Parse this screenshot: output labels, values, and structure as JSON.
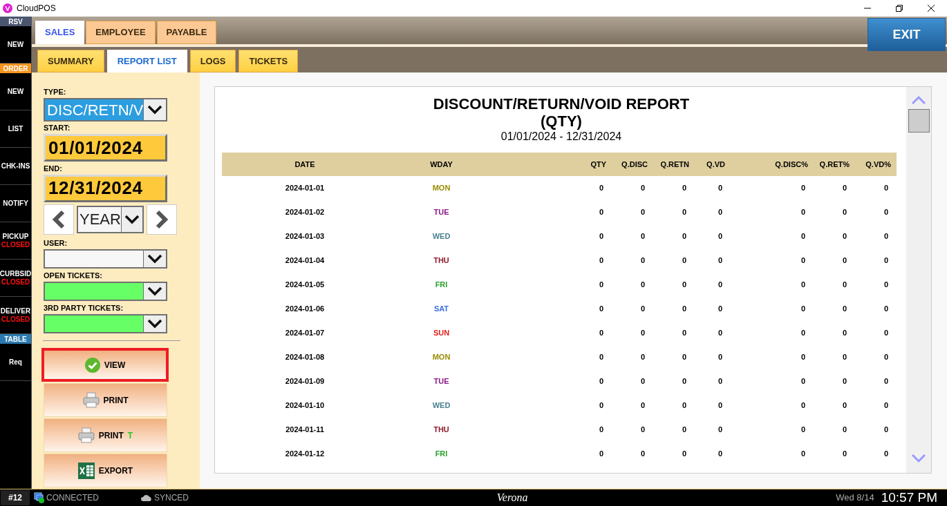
{
  "window": {
    "title": "CloudPOS"
  },
  "sidebar": [
    {
      "kind": "header",
      "label": "RSV",
      "color": "#4a5670"
    },
    {
      "kind": "item",
      "label": "NEW"
    },
    {
      "kind": "header",
      "label": "ORDER",
      "color": "#f7941d"
    },
    {
      "kind": "item",
      "label": "NEW"
    },
    {
      "kind": "item",
      "label": "LIST"
    },
    {
      "kind": "item",
      "label": "CHK-INS"
    },
    {
      "kind": "item",
      "label": "NOTIFY"
    },
    {
      "kind": "item",
      "label": "PICKUP",
      "status": "CLOSED"
    },
    {
      "kind": "item",
      "label": "CURBSID",
      "status": "CLOSED"
    },
    {
      "kind": "item",
      "label": "DELIVER",
      "status": "CLOSED"
    },
    {
      "kind": "header",
      "label": "TABLE",
      "color": "#2a7ab0"
    },
    {
      "kind": "item",
      "label": "Req"
    }
  ],
  "tabs": [
    {
      "label": "SALES",
      "selected": true
    },
    {
      "label": "EMPLOYEE",
      "selected": false
    },
    {
      "label": "PAYABLE",
      "selected": false
    }
  ],
  "exit_button": "EXIT",
  "subtabs": [
    {
      "label": "SUMMARY",
      "selected": false
    },
    {
      "label": "REPORT LIST",
      "selected": true
    },
    {
      "label": "LOGS",
      "selected": false
    },
    {
      "label": "TICKETS",
      "selected": false
    }
  ],
  "filters": {
    "type": {
      "label": "TYPE:",
      "value": "DISC/RETN/V"
    },
    "start": {
      "label": "START:",
      "value": "01/01/2024"
    },
    "end": {
      "label": "END:",
      "value": "12/31/2024"
    },
    "period": {
      "value": "YEAR"
    },
    "user": {
      "label": "USER:"
    },
    "open_tickets": {
      "label": "OPEN TICKETS:"
    },
    "third_party_tickets": {
      "label": "3RD PARTY TICKETS:"
    }
  },
  "actions": [
    {
      "kind": "view",
      "label": "VIEW",
      "selected": true
    },
    {
      "kind": "print",
      "label": "PRINT",
      "selected": false
    },
    {
      "kind": "print",
      "label": "PRINT",
      "suffix": "T",
      "selected": false
    },
    {
      "kind": "export",
      "label": "EXPORT",
      "selected": false
    }
  ],
  "report": {
    "title": "DISCOUNT/RETURN/VOID REPORT",
    "subtitle": "(QTY)",
    "range": "01/01/2024 - 12/31/2024",
    "columns": [
      "DATE",
      "WDAY",
      "QTY",
      "Q.DISC",
      "Q.RETN",
      "Q.VD",
      "Q.DISC%",
      "Q.RET%",
      "Q.VD%"
    ],
    "rows": [
      {
        "date": "2024-01-01",
        "wday": "MON",
        "color": "#9a8c00",
        "values": [
          "0",
          "0",
          "0",
          "0",
          "0",
          "0",
          "0"
        ]
      },
      {
        "date": "2024-01-02",
        "wday": "TUE",
        "color": "#8b1a8b",
        "values": [
          "0",
          "0",
          "0",
          "0",
          "0",
          "0",
          "0"
        ]
      },
      {
        "date": "2024-01-03",
        "wday": "WED",
        "color": "#4a7f8f",
        "values": [
          "0",
          "0",
          "0",
          "0",
          "0",
          "0",
          "0"
        ]
      },
      {
        "date": "2024-01-04",
        "wday": "THU",
        "color": "#8b1a2a",
        "values": [
          "0",
          "0",
          "0",
          "0",
          "0",
          "0",
          "0"
        ]
      },
      {
        "date": "2024-01-05",
        "wday": "FRI",
        "color": "#2aa02a",
        "values": [
          "0",
          "0",
          "0",
          "0",
          "0",
          "0",
          "0"
        ]
      },
      {
        "date": "2024-01-06",
        "wday": "SAT",
        "color": "#3a6fe0",
        "values": [
          "0",
          "0",
          "0",
          "0",
          "0",
          "0",
          "0"
        ]
      },
      {
        "date": "2024-01-07",
        "wday": "SUN",
        "color": "#e02020",
        "values": [
          "0",
          "0",
          "0",
          "0",
          "0",
          "0",
          "0"
        ]
      },
      {
        "date": "2024-01-08",
        "wday": "MON",
        "color": "#9a8c00",
        "values": [
          "0",
          "0",
          "0",
          "0",
          "0",
          "0",
          "0"
        ]
      },
      {
        "date": "2024-01-09",
        "wday": "TUE",
        "color": "#8b1a8b",
        "values": [
          "0",
          "0",
          "0",
          "0",
          "0",
          "0",
          "0"
        ]
      },
      {
        "date": "2024-01-10",
        "wday": "WED",
        "color": "#4a7f8f",
        "values": [
          "0",
          "0",
          "0",
          "0",
          "0",
          "0",
          "0"
        ]
      },
      {
        "date": "2024-01-11",
        "wday": "THU",
        "color": "#8b1a2a",
        "values": [
          "0",
          "0",
          "0",
          "0",
          "0",
          "0",
          "0"
        ]
      },
      {
        "date": "2024-01-12",
        "wday": "FRI",
        "color": "#2aa02a",
        "values": [
          "0",
          "0",
          "0",
          "0",
          "0",
          "0",
          "0"
        ]
      }
    ]
  },
  "status_bar": {
    "terminal": "#12",
    "connection": "CONNECTED",
    "sync": "SYNCED",
    "location": "Verona",
    "date": "Wed 8/14",
    "time": "10:57 PM"
  }
}
